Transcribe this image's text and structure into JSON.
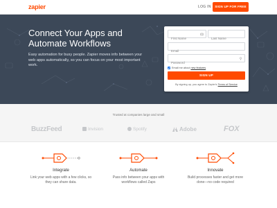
{
  "header": {
    "logo": "zapier",
    "login_label": "LOG IN",
    "signup_label": "SIGN UP FOR FREE"
  },
  "hero": {
    "title_line1": "Connect Your Apps and",
    "title_line2": "Automate Workflows",
    "subtitle": "Easy automation for busy people. Zapier moves info between your web apps automatically, so you can focus on your most important work."
  },
  "form": {
    "first_name_placeholder": "First Name",
    "last_name_placeholder": "Last Name",
    "email_placeholder": "Email",
    "password_placeholder": "Password",
    "checkbox_text": "Email me about",
    "checkbox_link": "new features",
    "checkbox_checked": true,
    "signup_label": "SIGN UP",
    "terms_prefix": "By signing up, you agree to Zapier's",
    "terms_link": "Terms of Service",
    "accent_color": "#ff4a00",
    "checkbox_color": "#1a73e8"
  },
  "trusted": {
    "label": "Trusted at companies large and small",
    "brands": [
      "BuzzFeed",
      "Invision",
      "Spotify",
      "Adobe",
      "FOX"
    ]
  },
  "features": [
    {
      "title": "Integrate",
      "desc_line1": "Link your web apps with a few clicks, so",
      "desc_line2": "they can share data."
    },
    {
      "title": "Automate",
      "desc_line1": "Pass info between your apps with",
      "desc_line2": "workflows called Zaps"
    },
    {
      "title": "Innovate",
      "desc_line1": "Build processes faster and get more",
      "desc_line2": "done—no code required"
    }
  ],
  "colors": {
    "brand": "#ff4a00",
    "hero_bg": "#3c4858",
    "trusted_bg": "#f5f5f5"
  }
}
